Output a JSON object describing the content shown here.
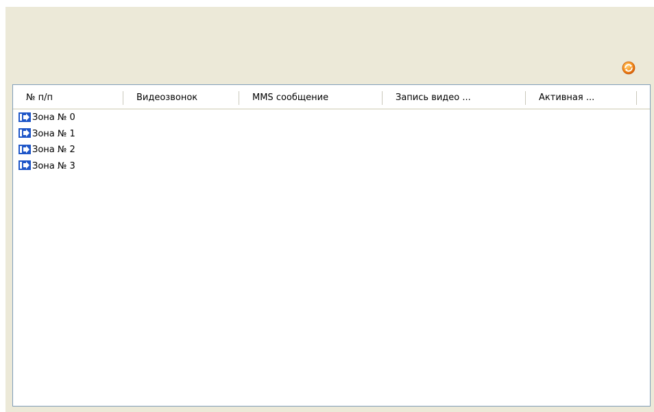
{
  "toolbar": {
    "refresh_icon": "refresh-icon",
    "accent_color": "#f5a623"
  },
  "table": {
    "columns": [
      {
        "label": "№ п/п"
      },
      {
        "label": "Видеозвонок"
      },
      {
        "label": "MMS сообщение"
      },
      {
        "label": "Запись видео ..."
      },
      {
        "label": "Активная ..."
      }
    ],
    "rows": [
      {
        "label": "Зона № 0",
        "icon": "zone-icon"
      },
      {
        "label": "Зона № 1",
        "icon": "zone-icon"
      },
      {
        "label": "Зона № 2",
        "icon": "zone-icon"
      },
      {
        "label": "Зона № 3",
        "icon": "zone-icon"
      }
    ]
  },
  "colors": {
    "panel_background": "#ece9d8",
    "grid_border": "#7f9db9",
    "zone_icon": "#1e56c8"
  }
}
